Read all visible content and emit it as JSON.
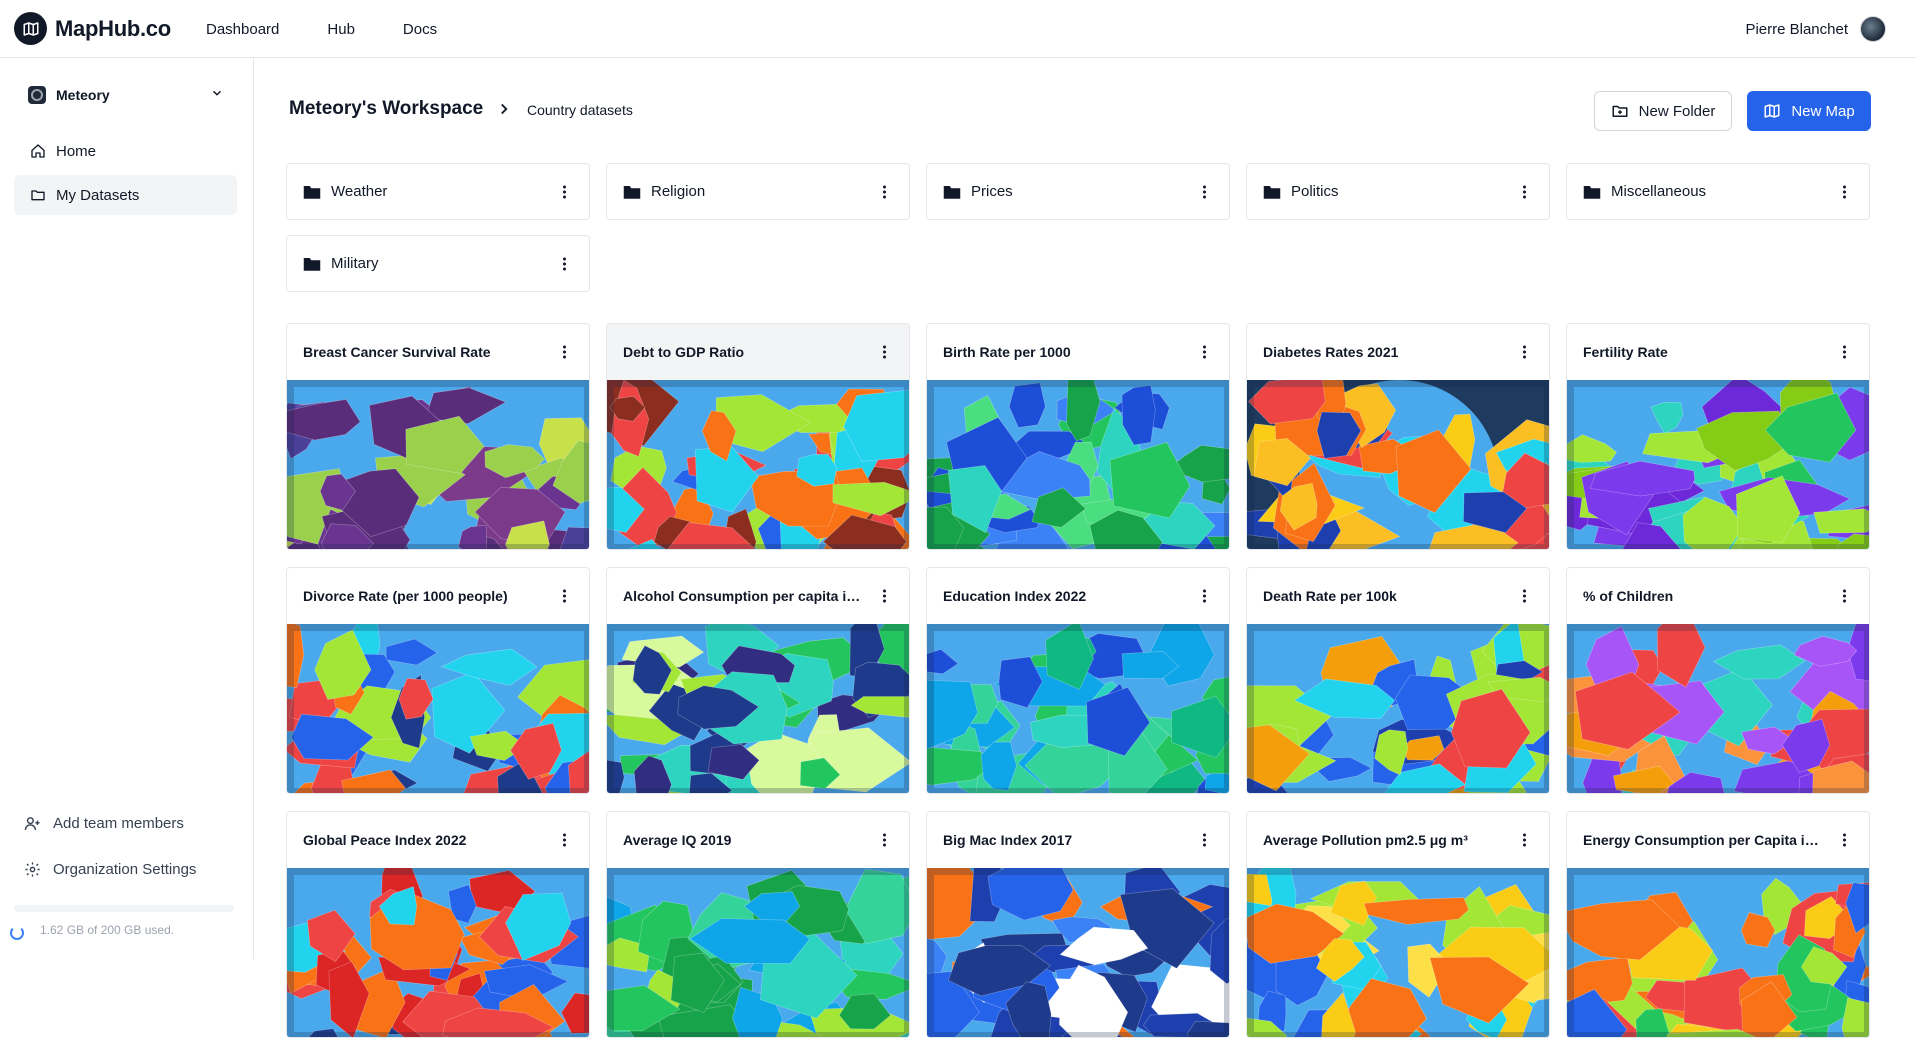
{
  "brand": {
    "name": "MapHub.co",
    "logo_icon": "map-icon"
  },
  "topnav": {
    "items": [
      "Dashboard",
      "Hub",
      "Docs"
    ]
  },
  "user": {
    "name": "Pierre Blanchet"
  },
  "sidebar": {
    "workspace": "Meteory",
    "items": [
      {
        "label": "Home",
        "icon": "home-icon"
      },
      {
        "label": "My Datasets",
        "icon": "folder-icon",
        "active": true
      }
    ],
    "bottom": [
      {
        "label": "Add team members",
        "icon": "user-plus-icon"
      },
      {
        "label": "Organization Settings",
        "icon": "gear-icon"
      }
    ],
    "storage_text": "1.62 GB of 200 GB used.",
    "storage_fraction": 0.0081
  },
  "main": {
    "breadcrumb": {
      "title": "Meteory's Workspace",
      "current": "Country datasets"
    },
    "new_folder_label": "New Folder",
    "new_map_label": "New Map",
    "folders": [
      "Weather",
      "Religion",
      "Prices",
      "Politics",
      "Miscellaneous",
      "Military"
    ],
    "maps": [
      {
        "title": "Breast Cancer Survival Rate",
        "palette": [
          "#7c3a8a",
          "#5a2d7a",
          "#9ad04c",
          "#4b3f9a",
          "#c8e04a",
          "#6a3590"
        ]
      },
      {
        "title": "Debt to GDP Ratio",
        "palette": [
          "#ef4444",
          "#f97316",
          "#a3e635",
          "#22d3ee",
          "#8b2d1f",
          "#2563eb"
        ]
      },
      {
        "title": "Birth Rate per 1000",
        "palette": [
          "#4ade80",
          "#1d4ed8",
          "#22c55e",
          "#3b82f6",
          "#2dd4bf",
          "#16a34a"
        ]
      },
      {
        "title": "Diabetes Rates 2021",
        "palette": [
          "#fbbf24",
          "#ef4444",
          "#1e40af",
          "#f97316",
          "#22d3ee",
          "#facc15"
        ]
      },
      {
        "title": "Fertility Rate",
        "palette": [
          "#7c3aed",
          "#a3e635",
          "#22c55e",
          "#2dd4bf",
          "#6d28d9",
          "#84cc16"
        ]
      },
      {
        "title": "Divorce Rate (per 1000 people)",
        "palette": [
          "#ef4444",
          "#f97316",
          "#2563eb",
          "#22d3ee",
          "#a3e635",
          "#1e3a8a"
        ]
      },
      {
        "title": "Alcohol Consumption per capita in ...",
        "palette": [
          "#d9f99d",
          "#1e3a8a",
          "#312e81",
          "#22c55e",
          "#2dd4bf",
          "#a3e635"
        ]
      },
      {
        "title": "Education Index 2022",
        "palette": [
          "#22c55e",
          "#2dd4bf",
          "#10b981",
          "#0ea5e9",
          "#1d4ed8",
          "#34d399"
        ]
      },
      {
        "title": "Death Rate per 100k",
        "palette": [
          "#ef4444",
          "#f59e0b",
          "#2563eb",
          "#a3e635",
          "#22d3ee",
          "#1e40af"
        ]
      },
      {
        "title": "% of Children",
        "palette": [
          "#7c3aed",
          "#f59e0b",
          "#ef4444",
          "#2dd4bf",
          "#a855f7",
          "#fb923c"
        ]
      },
      {
        "title": "Global Peace Index 2022",
        "palette": [
          "#2563eb",
          "#ef4444",
          "#f97316",
          "#22d3ee",
          "#1e3a8a",
          "#dc2626"
        ]
      },
      {
        "title": "Average IQ 2019",
        "palette": [
          "#22c55e",
          "#2dd4bf",
          "#a3e635",
          "#0ea5e9",
          "#34d399",
          "#16a34a"
        ]
      },
      {
        "title": "Big Mac Index 2017",
        "palette": [
          "#f97316",
          "#1e40af",
          "#2563eb",
          "#3b82f6",
          "#ffffff",
          "#1e3a8a"
        ]
      },
      {
        "title": "Average Pollution pm2.5 μg m³",
        "palette": [
          "#facc15",
          "#f97316",
          "#a3e635",
          "#22d3ee",
          "#2563eb",
          "#fde047"
        ]
      },
      {
        "title": "Energy Consumption per Capita in ...",
        "palette": [
          "#ef4444",
          "#22c55e",
          "#f97316",
          "#2563eb",
          "#a3e635",
          "#facc15"
        ]
      }
    ]
  },
  "colors": {
    "accent": "#2563eb",
    "border": "#e5e7eb",
    "ocean": "#3fa0e8"
  }
}
